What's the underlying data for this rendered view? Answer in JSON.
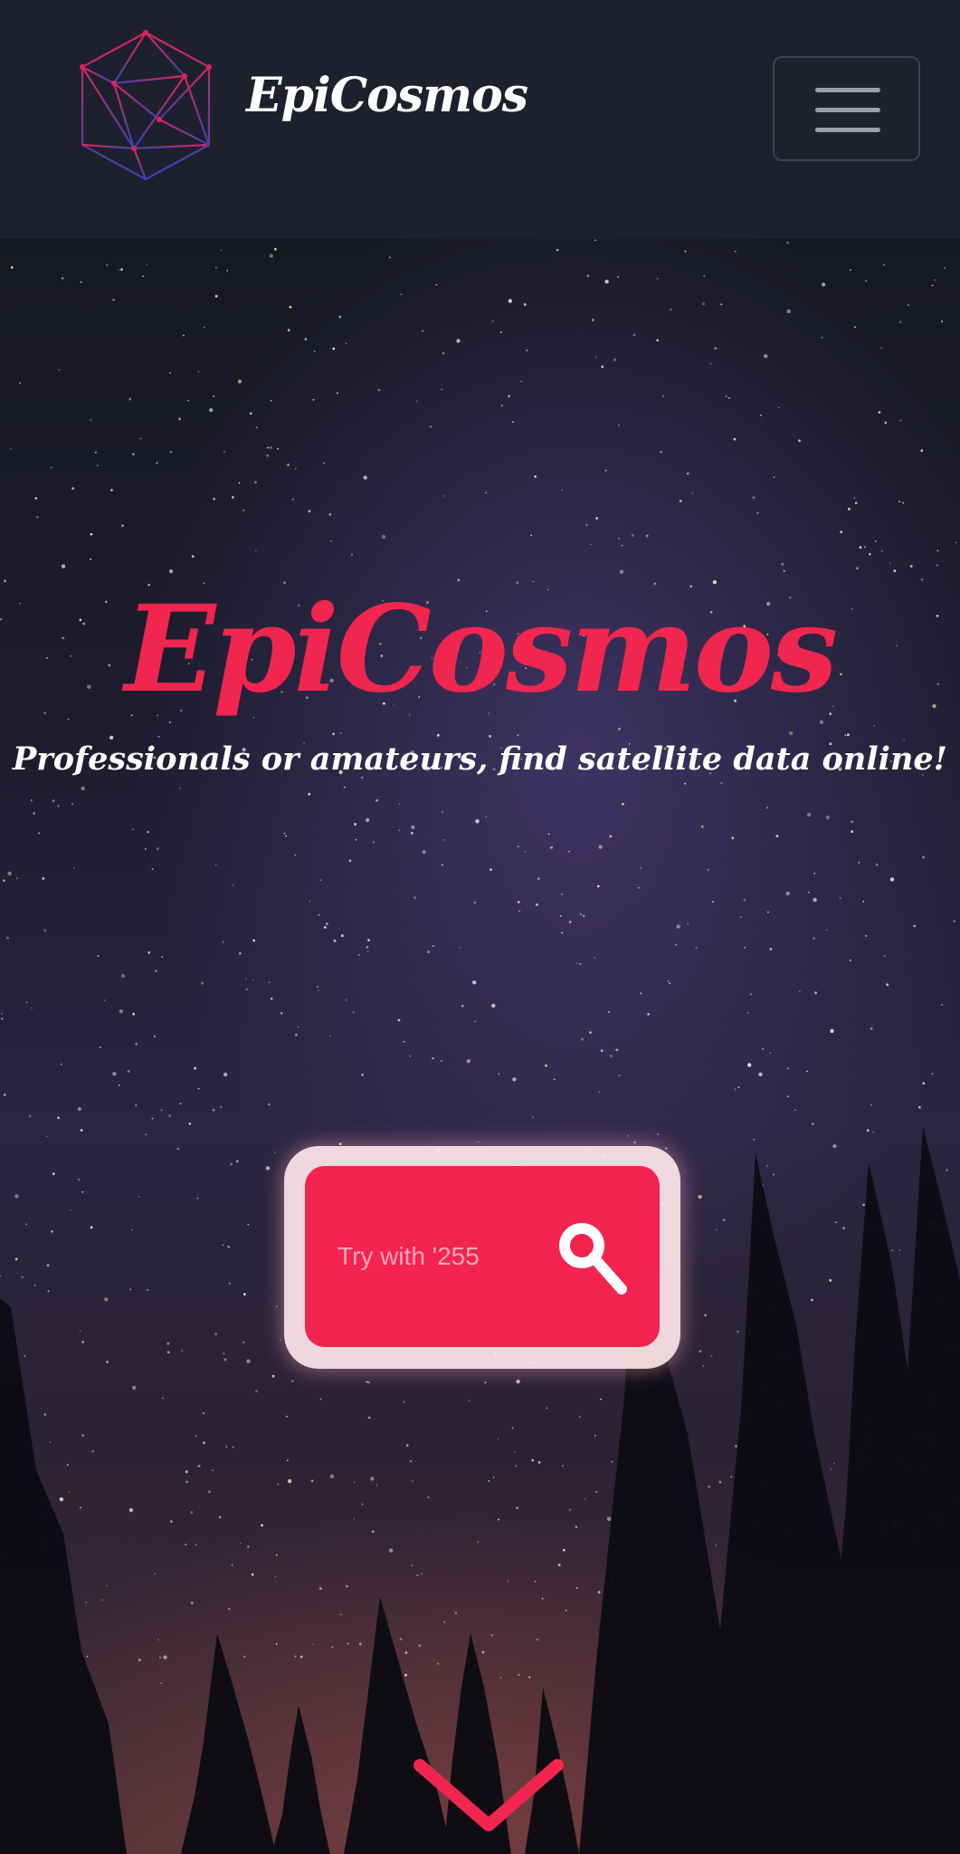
{
  "navbar": {
    "brand": "EpiCosmos",
    "logo_icon": "geodesic-network-logo",
    "menu_icon": "hamburger-menu-icon"
  },
  "hero": {
    "title": "EpiCosmos",
    "subtitle": "Professionals or amateurs, find satellite data online!",
    "search": {
      "placeholder": "Try with '255",
      "value": "",
      "button_icon": "search-key-icon"
    },
    "scroll_icon": "chevron-down-icon"
  },
  "colors": {
    "accent": "#f0264f",
    "navbar_bg": "#1c212d",
    "text_light": "#ffffff"
  }
}
